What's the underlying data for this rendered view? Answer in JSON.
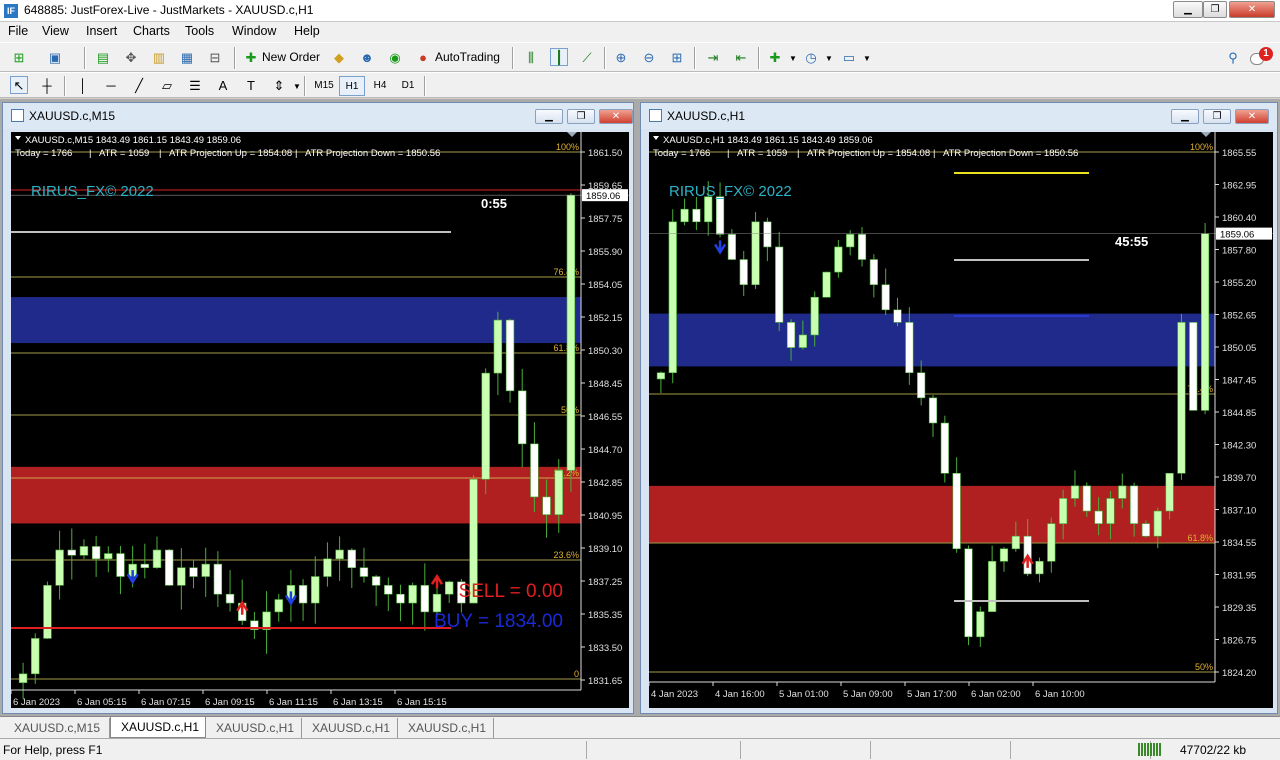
{
  "window": {
    "title": "648885: JustForex-Live - JustMarkets - XAUUSD.c,H1",
    "app_icon": "IF"
  },
  "menu": [
    "File",
    "View",
    "Insert",
    "Charts",
    "Tools",
    "Window",
    "Help"
  ],
  "toolbar": {
    "new_order": "New Order",
    "autotrading": "AutoTrading",
    "alert_count": "1"
  },
  "timeframes": [
    {
      "label": "M15",
      "active": false
    },
    {
      "label": "H1",
      "active": true
    },
    {
      "label": "H4",
      "active": false
    },
    {
      "label": "D1",
      "active": false
    }
  ],
  "charts": [
    {
      "window_title": "XAUUSD.c,M15",
      "header": "XAUUSD.c,M15  1843.49 1861.15 1843.49 1859.06",
      "info": [
        "Today = 1766",
        "ATR = 1059",
        "ATR Projection Up = 1854.08",
        "ATR Projection Down = 1850.56"
      ],
      "watermark": "RIRUS_FX© 2022",
      "timer": "0:55",
      "sell_label": "SELL = 0.00",
      "buy_label": "BUY = 1834.00",
      "price_axis": [
        "1861.50",
        "1859.65",
        "1857.75",
        "1855.90",
        "1854.05",
        "1852.15",
        "1850.30",
        "1848.45",
        "1846.55",
        "1844.70",
        "1842.85",
        "1840.95",
        "1839.10",
        "1837.25",
        "1835.35",
        "1833.50",
        "1831.65"
      ],
      "current_price": "1859.06",
      "fib_levels": [
        "100%",
        "76.4%",
        "61.8%",
        "50%",
        "38.2%",
        "23.6%",
        "0"
      ],
      "time_axis": [
        "6 Jan 2023",
        "6 Jan 05:15",
        "6 Jan 07:15",
        "6 Jan 09:15",
        "6 Jan 11:15",
        "6 Jan 13:15",
        "6 Jan 15:15"
      ],
      "zones": {
        "blue": [
          1850.7,
          1853.3
        ],
        "red": [
          1840.5,
          1843.7
        ]
      }
    },
    {
      "window_title": "XAUUSD.c,H1",
      "header": "XAUUSD.c,H1  1843.49 1861.15 1843.49 1859.06",
      "info": [
        "Today = 1766",
        "ATR = 1059",
        "ATR Projection Up = 1854.08",
        "ATR Projection Down = 1850.56"
      ],
      "watermark": "RIRUS_FX© 2022",
      "timer": "45:55",
      "price_axis": [
        "1865.55",
        "1862.95",
        "1860.40",
        "1857.80",
        "1855.20",
        "1852.65",
        "1850.05",
        "1847.45",
        "1844.85",
        "1842.30",
        "1839.70",
        "1837.10",
        "1834.55",
        "1831.95",
        "1829.35",
        "1826.75",
        "1824.20"
      ],
      "current_price": "1859.06",
      "fib_levels": [
        "100%",
        "76.4%",
        "61.8%",
        "50%"
      ],
      "time_axis": [
        "4 Jan 2023",
        "4 Jan 16:00",
        "5 Jan 01:00",
        "5 Jan 09:00",
        "5 Jan 17:00",
        "6 Jan 02:00",
        "6 Jan 10:00"
      ],
      "zones": {
        "blue": [
          1848.5,
          1852.7
        ],
        "red": [
          1834.5,
          1839.0
        ]
      }
    }
  ],
  "tabs": [
    {
      "label": "XAUUSD.c,M15",
      "active": false
    },
    {
      "label": "XAUUSD.c,H1",
      "active": true
    },
    {
      "label": "XAUUSD.c,H1",
      "active": false
    },
    {
      "label": "XAUUSD.c,H1",
      "active": false
    },
    {
      "label": "XAUUSD.c,H1",
      "active": false
    }
  ],
  "status": {
    "help": "For Help, press F1",
    "network": "47702/22 kb"
  },
  "colors": {
    "bull": "#c8ffb0",
    "bear": "#ffffff",
    "wick": "#4caf3a",
    "fib": "#d8d060",
    "blue_zone": "#1f2a8a",
    "red_zone": "#b02020",
    "watermark": "#2bb4c8"
  }
}
